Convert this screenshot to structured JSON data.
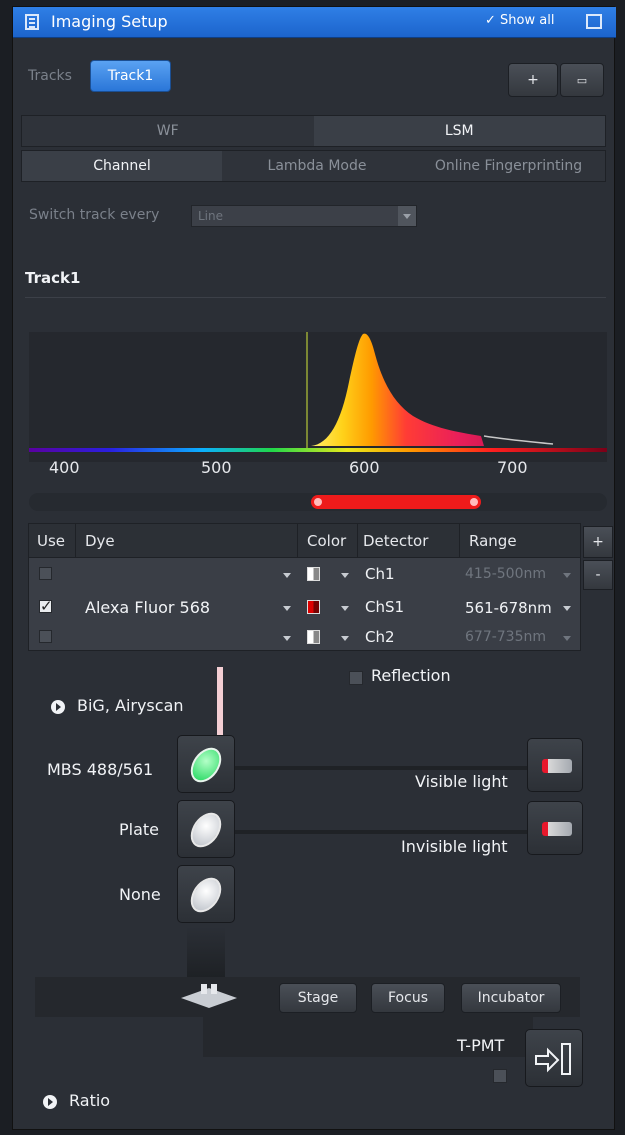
{
  "window": {
    "title": "Imaging Setup",
    "show_all": "✓ Show all"
  },
  "tracks": {
    "label": "Tracks",
    "items": [
      "Track1"
    ],
    "add": "+",
    "remove": "▭"
  },
  "mode_tabs": [
    "WF",
    "LSM"
  ],
  "mode_selected": "LSM",
  "sub_tabs": [
    "Channel",
    "Lambda Mode",
    "Online Fingerprinting"
  ],
  "sub_selected": "Channel",
  "switch_track": {
    "label": "Switch track every",
    "value": "Line"
  },
  "track_heading": "Track1",
  "spectrum": {
    "ticks": [
      "400",
      "500",
      "600",
      "700"
    ],
    "laser_nm": 561,
    "range_nm": [
      561,
      678
    ]
  },
  "channel_table": {
    "headers": [
      "Use",
      "Dye",
      "Color",
      "Detector",
      "Range"
    ],
    "add": "+",
    "remove": "-",
    "rows": [
      {
        "use": false,
        "dye": "",
        "color": "#ffffff",
        "detector": "Ch1",
        "range": "415-500nm"
      },
      {
        "use": true,
        "dye": "Alexa Fluor 568",
        "color": "#cc0000",
        "detector": "ChS1",
        "range": "561-678nm"
      },
      {
        "use": false,
        "dye": "",
        "color": "#ffffff",
        "detector": "Ch2",
        "range": "677-735nm"
      }
    ]
  },
  "reflection": "Reflection",
  "big_airyscan": "BiG, Airyscan",
  "light_path": {
    "filters": [
      "MBS 488/561",
      "Plate",
      "None"
    ],
    "lamps": [
      "Visible light",
      "Invisible light"
    ]
  },
  "stage_buttons": [
    "Stage",
    "Focus",
    "Incubator"
  ],
  "tpmt": "T-PMT",
  "ratio": "Ratio",
  "colors": {
    "accent": "#2a76d8",
    "emission_range": "#ee1b1b"
  }
}
